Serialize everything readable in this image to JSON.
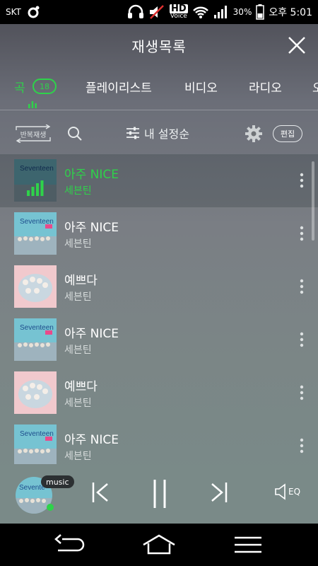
{
  "status_bar": {
    "carrier": "SKT",
    "hd_voice_top": "HD",
    "hd_voice_bottom": "Voice",
    "battery": "30%",
    "time": "오후 5:01"
  },
  "header": {
    "title": "재생목록"
  },
  "tabs": [
    {
      "label": "곡",
      "badge": "18",
      "active": true
    },
    {
      "label": "플레이리스트"
    },
    {
      "label": "비디오"
    },
    {
      "label": "라디오"
    },
    {
      "label": "오"
    }
  ],
  "toolbar": {
    "repeat_label": "반복재생",
    "sort_label": "내 설정순",
    "edit_label": "편집"
  },
  "songs": [
    {
      "title": "아주 NICE",
      "artist": "세븐틴",
      "cover": "nice",
      "playing": true
    },
    {
      "title": "아주 NICE",
      "artist": "세븐틴",
      "cover": "nice"
    },
    {
      "title": "예쁘다",
      "artist": "세븐틴",
      "cover": "pretty"
    },
    {
      "title": "아주 NICE",
      "artist": "세븐틴",
      "cover": "nice"
    },
    {
      "title": "예쁘다",
      "artist": "세븐틴",
      "cover": "pretty"
    },
    {
      "title": "아주 NICE",
      "artist": "세븐틴",
      "cover": "nice"
    }
  ],
  "player": {
    "tag": "music",
    "eq_label": "EQ"
  },
  "colors": {
    "accent": "#2ed34a",
    "status_bar_bg": "#000000",
    "nav_bar_bg": "#000000"
  },
  "icons": {
    "header_close": "close-icon",
    "search": "search-icon",
    "sort": "sliders-icon",
    "settings": "gear-icon",
    "more": "more-vertical-icon",
    "prev": "skip-previous-icon",
    "pause": "pause-icon",
    "next": "skip-next-icon",
    "eq": "speaker-eq-icon",
    "back": "back-icon",
    "home": "home-icon",
    "menu": "menu-icon"
  }
}
